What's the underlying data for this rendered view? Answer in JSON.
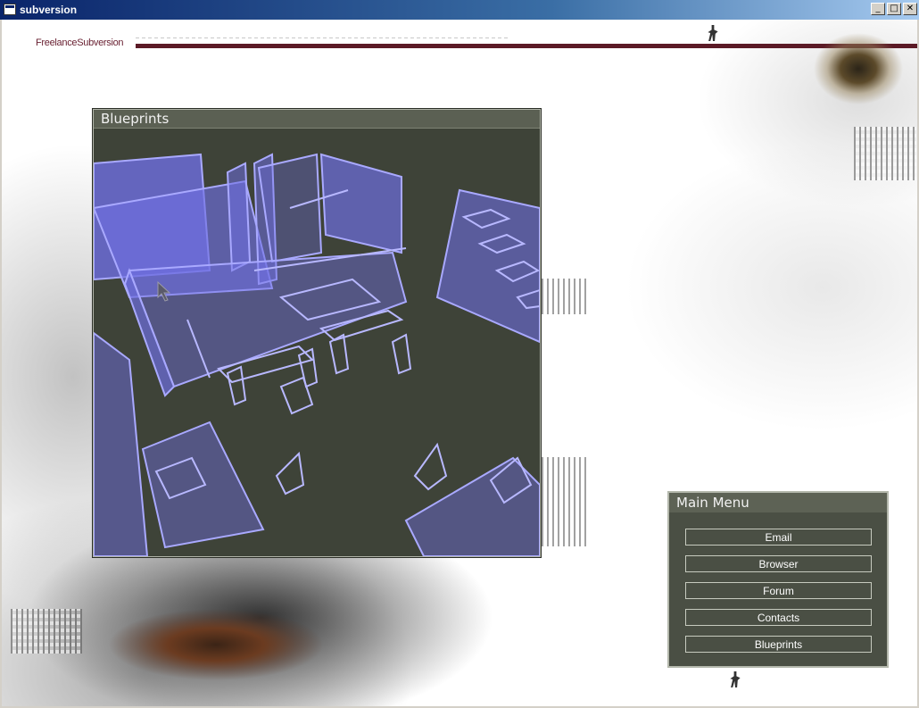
{
  "window": {
    "title": "subversion",
    "minimize_glyph": "_",
    "maximize_glyph": "□",
    "close_glyph": "✕"
  },
  "brand": {
    "text": "FreelanceSubversion"
  },
  "blueprints_panel": {
    "title": "Blueprints"
  },
  "main_menu": {
    "title": "Main Menu",
    "items": [
      {
        "label": "Email"
      },
      {
        "label": "Browser"
      },
      {
        "label": "Forum"
      },
      {
        "label": "Contacts"
      },
      {
        "label": "Blueprints"
      }
    ]
  },
  "colors": {
    "panel_bg": "#3e4338",
    "panel_header": "#5b6053",
    "blueprint_stroke": "#a9a9ff",
    "blueprint_fill": "#6e6ee0",
    "brand_bar": "#5b1a26"
  }
}
